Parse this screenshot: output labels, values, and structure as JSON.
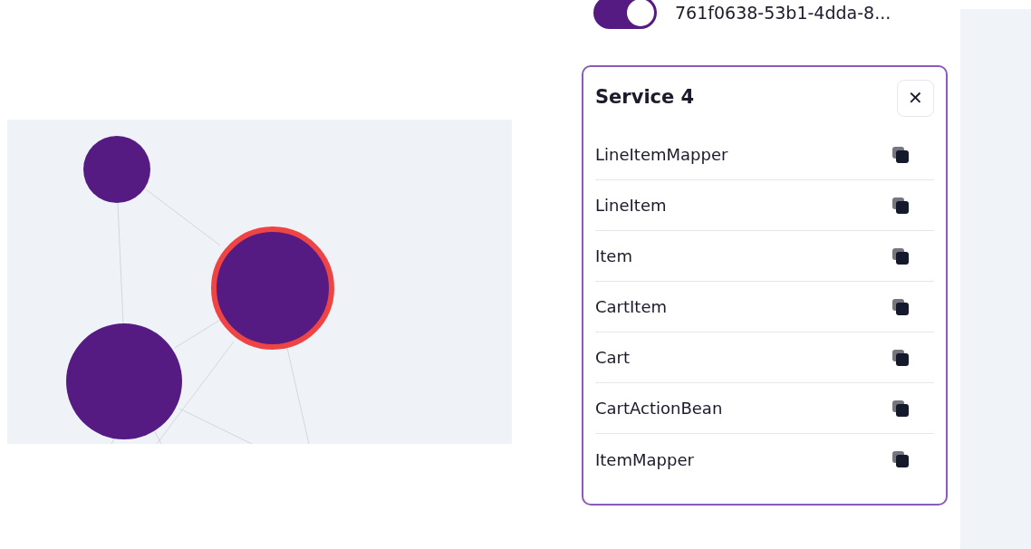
{
  "graph": {
    "nodes": [
      {
        "selected": false
      },
      {
        "selected": true
      },
      {
        "selected": false
      }
    ]
  },
  "service_toggle": {
    "on": true,
    "label": "761f0638-53b1-4dda-8..."
  },
  "service_panel": {
    "title": "Service 4",
    "close": "✕",
    "items": [
      {
        "name": "LineItemMapper"
      },
      {
        "name": "LineItem"
      },
      {
        "name": "Item"
      },
      {
        "name": "CartItem"
      },
      {
        "name": "Cart"
      },
      {
        "name": "CartActionBean"
      },
      {
        "name": "ItemMapper"
      }
    ]
  }
}
